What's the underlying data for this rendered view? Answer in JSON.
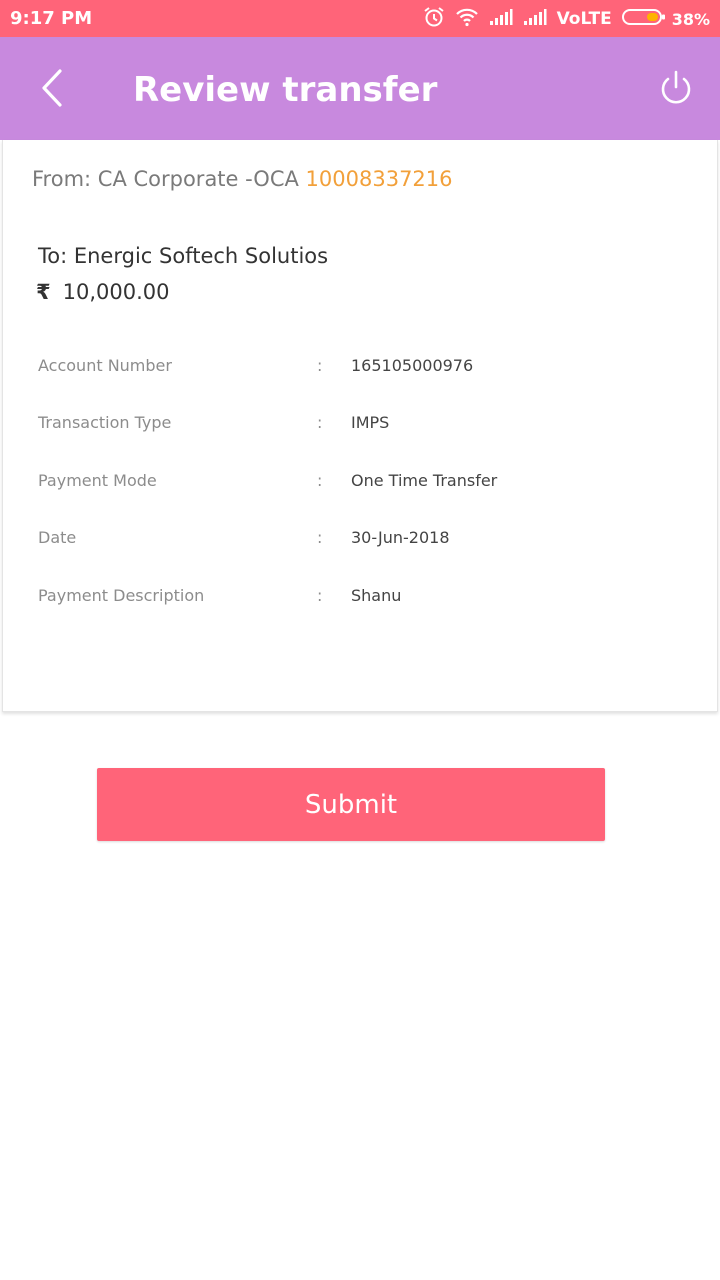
{
  "status_bar": {
    "time": "9:17 PM",
    "network": "VoLTE",
    "battery": "38%",
    "icons": [
      "alarm-icon",
      "wifi-icon",
      "signal-icon",
      "signal-icon",
      "battery-icon"
    ]
  },
  "header": {
    "title": "Review transfer",
    "back_icon": "chevron-left-icon",
    "power_icon": "power-icon",
    "background": "#c889de"
  },
  "transfer": {
    "from_label": "From: CA Corporate -OCA",
    "from_account": "10008337216",
    "to": "To: Energic Softech Solutios",
    "currency_symbol": "₹",
    "amount": "10,000.00"
  },
  "details": [
    {
      "label": "Account Number",
      "value": "165105000976"
    },
    {
      "label": "Transaction Type",
      "value": "IMPS"
    },
    {
      "label": "Payment Mode",
      "value": "One Time Transfer"
    },
    {
      "label": "Date",
      "value": "30-Jun-2018"
    },
    {
      "label": "Payment Description",
      "value": "Shanu"
    }
  ],
  "separator": ":",
  "actions": {
    "submit_label": "Submit"
  },
  "colors": {
    "accent": "#ff6479",
    "account_highlight": "#f2a03a"
  }
}
